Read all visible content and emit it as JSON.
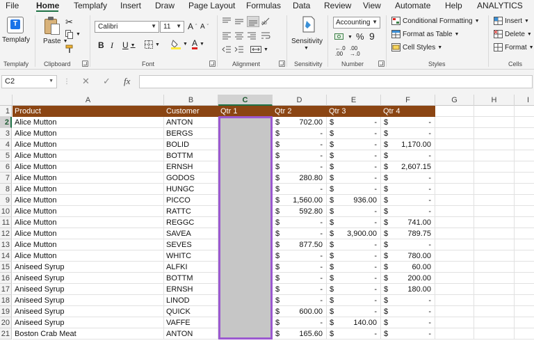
{
  "tabs": [
    "File",
    "Home",
    "Templafy",
    "Insert",
    "Draw",
    "Page Layout",
    "Formulas",
    "Data",
    "Review",
    "View",
    "Automate",
    "Help",
    "ANALYTICS"
  ],
  "active_tab": "Home",
  "ribbon": {
    "templafy": {
      "button_label": "Templafy",
      "group_label": "Templafy"
    },
    "clipboard": {
      "paste_label": "Paste",
      "group_label": "Clipboard"
    },
    "font": {
      "font_name": "Calibri",
      "font_size": "11",
      "group_label": "Font"
    },
    "alignment": {
      "group_label": "Alignment"
    },
    "sensitivity": {
      "button_label": "Sensitivity",
      "group_label": "Sensitivity"
    },
    "number": {
      "format": "Accounting",
      "group_label": "Number"
    },
    "styles": {
      "conditional_formatting": "Conditional Formatting",
      "format_as_table": "Format as Table",
      "cell_styles": "Cell Styles",
      "group_label": "Styles"
    },
    "cells": {
      "insert": "Insert",
      "delete": "Delete",
      "format": "Format",
      "group_label": "Cells"
    }
  },
  "formula_bar": {
    "name_box": "C2",
    "fx_label": "fx",
    "formula": ""
  },
  "sheet": {
    "column_headers": [
      "A",
      "B",
      "C",
      "D",
      "E",
      "F",
      "G",
      "H",
      "I"
    ],
    "selected_column": "C",
    "header_fill": "#8b4513",
    "selection_border": "#9b59d0",
    "header_row": [
      "Product",
      "Customer",
      "Qtr 1",
      "Qtr 2",
      "Qtr 3",
      "Qtr 4"
    ],
    "currency_symbol": "$",
    "rows": [
      {
        "n": "2",
        "product": "Alice Mutton",
        "customer": "ANTON",
        "q2": "702.00",
        "q3": "-",
        "q4": "-"
      },
      {
        "n": "3",
        "product": "Alice Mutton",
        "customer": "BERGS",
        "q2": "-",
        "q3": "-",
        "q4": "-"
      },
      {
        "n": "4",
        "product": "Alice Mutton",
        "customer": "BOLID",
        "q2": "-",
        "q3": "-",
        "q4": "1,170.00"
      },
      {
        "n": "5",
        "product": "Alice Mutton",
        "customer": "BOTTM",
        "q2": "-",
        "q3": "-",
        "q4": "-"
      },
      {
        "n": "6",
        "product": "Alice Mutton",
        "customer": "ERNSH",
        "q2": "-",
        "q3": "-",
        "q4": "2,607.15"
      },
      {
        "n": "7",
        "product": "Alice Mutton",
        "customer": "GODOS",
        "q2": "280.80",
        "q3": "-",
        "q4": "-"
      },
      {
        "n": "8",
        "product": "Alice Mutton",
        "customer": "HUNGC",
        "q2": "-",
        "q3": "-",
        "q4": "-"
      },
      {
        "n": "9",
        "product": "Alice Mutton",
        "customer": "PICCO",
        "q2": "1,560.00",
        "q3": "936.00",
        "q4": "-"
      },
      {
        "n": "10",
        "product": "Alice Mutton",
        "customer": "RATTC",
        "q2": "592.80",
        "q3": "-",
        "q4": "-"
      },
      {
        "n": "11",
        "product": "Alice Mutton",
        "customer": "REGGC",
        "q2": "-",
        "q3": "-",
        "q4": "741.00"
      },
      {
        "n": "12",
        "product": "Alice Mutton",
        "customer": "SAVEA",
        "q2": "-",
        "q3": "3,900.00",
        "q4": "789.75"
      },
      {
        "n": "13",
        "product": "Alice Mutton",
        "customer": "SEVES",
        "q2": "877.50",
        "q3": "-",
        "q4": "-"
      },
      {
        "n": "14",
        "product": "Alice Mutton",
        "customer": "WHITC",
        "q2": "-",
        "q3": "-",
        "q4": "780.00"
      },
      {
        "n": "15",
        "product": "Aniseed Syrup",
        "customer": "ALFKI",
        "q2": "-",
        "q3": "-",
        "q4": "60.00"
      },
      {
        "n": "16",
        "product": "Aniseed Syrup",
        "customer": "BOTTM",
        "q2": "-",
        "q3": "-",
        "q4": "200.00"
      },
      {
        "n": "17",
        "product": "Aniseed Syrup",
        "customer": "ERNSH",
        "q2": "-",
        "q3": "-",
        "q4": "180.00"
      },
      {
        "n": "18",
        "product": "Aniseed Syrup",
        "customer": "LINOD",
        "q2": "-",
        "q3": "-",
        "q4": "-"
      },
      {
        "n": "19",
        "product": "Aniseed Syrup",
        "customer": "QUICK",
        "q2": "600.00",
        "q3": "-",
        "q4": "-"
      },
      {
        "n": "20",
        "product": "Aniseed Syrup",
        "customer": "VAFFE",
        "q2": "-",
        "q3": "140.00",
        "q4": "-"
      },
      {
        "n": "21",
        "product": "Boston Crab Meat",
        "customer": "ANTON",
        "q2": "165.60",
        "q3": "-",
        "q4": "-"
      }
    ]
  }
}
